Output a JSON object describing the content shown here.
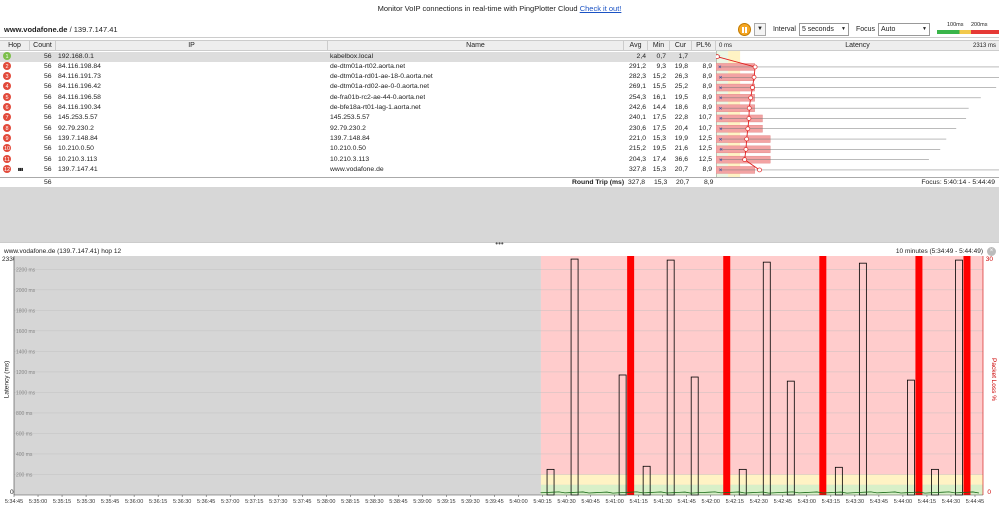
{
  "banner": {
    "text": "Monitor VoIP connections in real-time with PingPlotter Cloud",
    "link": "Check it out!"
  },
  "target": {
    "name": "www.vodafone.de",
    "sep": " / ",
    "ip": "139.7.147.41"
  },
  "controls": {
    "interval_label": "Interval",
    "interval_value": "5 seconds",
    "focus_label": "Focus",
    "focus_value": "Auto",
    "scale_low": "100ms",
    "scale_high": "200ms"
  },
  "columns": {
    "hop": "Hop",
    "count": "Count",
    "ip": "IP",
    "name": "Name",
    "avg": "Avg",
    "min": "Min",
    "cur": "Cur",
    "pl": "PL%",
    "lat_min": "0 ms",
    "latency": "Latency",
    "lat_max": "2313 ms"
  },
  "hops": [
    {
      "hop": "1",
      "count": "56",
      "ip": "192.168.0.1",
      "name": "kabelbox.local",
      "avg": "2,4",
      "min": "0,7",
      "cur": "1,7",
      "pl": "",
      "avg_ms": 2.4,
      "min_ms": 0.7,
      "cur_ms": 1.7,
      "pl_num": 0
    },
    {
      "hop": "2",
      "count": "56",
      "ip": "84.116.198.84",
      "name": "de-dtm01a-rt02.aorta.net",
      "avg": "291,2",
      "min": "9,3",
      "cur": "19,8",
      "pl": "8,9",
      "avg_ms": 291.2,
      "min_ms": 9.3,
      "cur_ms": 19.8,
      "pl_num": 8.9
    },
    {
      "hop": "3",
      "count": "56",
      "ip": "84.116.191.73",
      "name": "de-dtm01a-rd01-ae-18-0.aorta.net",
      "avg": "282,3",
      "min": "15,2",
      "cur": "26,3",
      "pl": "8,9",
      "avg_ms": 282.3,
      "min_ms": 15.2,
      "cur_ms": 26.3,
      "pl_num": 8.9
    },
    {
      "hop": "4",
      "count": "56",
      "ip": "84.116.196.42",
      "name": "de-dtm01a-rd02-ae-0-0.aorta.net",
      "avg": "269,1",
      "min": "15,5",
      "cur": "25,2",
      "pl": "8,9",
      "avg_ms": 269.1,
      "min_ms": 15.5,
      "cur_ms": 25.2,
      "pl_num": 8.9
    },
    {
      "hop": "5",
      "count": "56",
      "ip": "84.116.196.58",
      "name": "de-fra01b-rc2-ae-44-0.aorta.net",
      "avg": "254,3",
      "min": "16,1",
      "cur": "19,5",
      "pl": "8,9",
      "avg_ms": 254.3,
      "min_ms": 16.1,
      "cur_ms": 19.5,
      "pl_num": 8.9
    },
    {
      "hop": "6",
      "count": "56",
      "ip": "84.116.190.34",
      "name": "de-bfe18a-rt01-lag-1.aorta.net",
      "avg": "242,6",
      "min": "14,4",
      "cur": "18,6",
      "pl": "8,9",
      "avg_ms": 242.6,
      "min_ms": 14.4,
      "cur_ms": 18.6,
      "pl_num": 8.9
    },
    {
      "hop": "7",
      "count": "56",
      "ip": "145.253.5.57",
      "name": "145.253.5.57",
      "avg": "240,1",
      "min": "17,5",
      "cur": "22,8",
      "pl": "10,7",
      "avg_ms": 240.1,
      "min_ms": 17.5,
      "cur_ms": 22.8,
      "pl_num": 10.7
    },
    {
      "hop": "8",
      "count": "56",
      "ip": "92.79.230.2",
      "name": "92.79.230.2",
      "avg": "230,6",
      "min": "17,5",
      "cur": "20,4",
      "pl": "10,7",
      "avg_ms": 230.6,
      "min_ms": 17.5,
      "cur_ms": 20.4,
      "pl_num": 10.7
    },
    {
      "hop": "9",
      "count": "56",
      "ip": "139.7.148.84",
      "name": "139.7.148.84",
      "avg": "221,0",
      "min": "15,3",
      "cur": "19,9",
      "pl": "12,5",
      "avg_ms": 221.0,
      "min_ms": 15.3,
      "cur_ms": 19.9,
      "pl_num": 12.5
    },
    {
      "hop": "10",
      "count": "56",
      "ip": "10.210.0.50",
      "name": "10.210.0.50",
      "avg": "215,2",
      "min": "19,5",
      "cur": "21,6",
      "pl": "12,5",
      "avg_ms": 215.2,
      "min_ms": 19.5,
      "cur_ms": 21.6,
      "pl_num": 12.5
    },
    {
      "hop": "11",
      "count": "56",
      "ip": "10.210.3.113",
      "name": "10.210.3.113",
      "avg": "204,3",
      "min": "17,4",
      "cur": "36,6",
      "pl": "12,5",
      "avg_ms": 204.3,
      "min_ms": 17.4,
      "cur_ms": 36.6,
      "pl_num": 12.5
    },
    {
      "hop": "12",
      "count": "56",
      "ip": "139.7.147.41",
      "name": "www.vodafone.de",
      "avg": "327,8",
      "min": "15,3",
      "cur": "20,7",
      "pl": "8,9",
      "avg_ms": 327.8,
      "min_ms": 15.3,
      "cur_ms": 20.7,
      "pl_num": 8.9
    }
  ],
  "summary": {
    "count": "56",
    "label": "Round Trip (ms)",
    "avg": "327,8",
    "min": "15,3",
    "cur": "20,7",
    "pl": "8,9",
    "focus": "Focus: 5:40:14 - 5:44:49"
  },
  "colors": {
    "loss_bg": "#ffcccc",
    "loss_bar": "#ff0000",
    "ok_band": "#fff3c4",
    "good_band": "#d8f0c8",
    "hop_bad": "#e24a3b",
    "hop_ok": "#7cbf4a"
  },
  "lower": {
    "title": "www.vodafone.de (139.7.147.41) hop 12",
    "range": "10 minutes (5:34:49 - 5:44:49)",
    "ylabel": "Latency (ms)",
    "rlabel": "Packet Loss %",
    "ymax": "2330",
    "ymin": "0",
    "rmax": "30",
    "rmin": "0"
  },
  "chart_data": {
    "type": "bar",
    "ylabel": "Latency (ms)",
    "y2label": "Packet Loss %",
    "ylim": [
      0,
      2330
    ],
    "y2lim": [
      0,
      30
    ],
    "gridlines_ms": [
      2200,
      2000,
      1800,
      1600,
      1400,
      1200,
      1000,
      800,
      600,
      400,
      200
    ],
    "grid_labels": [
      "2200 ms",
      "2000 ms",
      "1800 ms",
      "1600 ms",
      "1400 ms",
      "1200 ms",
      "1000 ms",
      "800 ms",
      "600 ms",
      "400 ms",
      "200 ms"
    ],
    "xticks": [
      "5:34:45",
      "5:35:00",
      "5:35:15",
      "5:35:30",
      "5:35:45",
      "5:36:00",
      "5:36:15",
      "5:36:30",
      "5:36:45",
      "5:37:00",
      "5:37:15",
      "5:37:30",
      "5:37:45",
      "5:38:00",
      "5:38:15",
      "5:38:30",
      "5:38:45",
      "5:39:00",
      "5:39:15",
      "5:39:30",
      "5:39:45",
      "5:40:00",
      "5:40:15",
      "5:40:30",
      "5:40:45",
      "5:41:00",
      "5:41:15",
      "5:41:30",
      "5:41:45",
      "5:42:00",
      "5:42:15",
      "5:42:30",
      "5:42:45",
      "5:43:00",
      "5:43:15",
      "5:43:30",
      "5:43:45",
      "5:44:00",
      "5:44:15",
      "5:44:30",
      "5:44:45"
    ],
    "spikes": [
      {
        "t": "5:40:20",
        "ms": 250
      },
      {
        "t": "5:40:35",
        "ms": 2300
      },
      {
        "t": "5:41:05",
        "ms": 1170
      },
      {
        "t": "5:41:20",
        "ms": 280
      },
      {
        "t": "5:41:35",
        "ms": 2290
      },
      {
        "t": "5:41:50",
        "ms": 1150
      },
      {
        "t": "5:42:20",
        "ms": 250
      },
      {
        "t": "5:42:35",
        "ms": 2270
      },
      {
        "t": "5:42:50",
        "ms": 1110
      },
      {
        "t": "5:43:20",
        "ms": 270
      },
      {
        "t": "5:43:35",
        "ms": 2260
      },
      {
        "t": "5:44:05",
        "ms": 1120
      },
      {
        "t": "5:44:20",
        "ms": 250
      },
      {
        "t": "5:44:35",
        "ms": 2290
      }
    ],
    "loss_events": [
      "5:41:10",
      "5:42:10",
      "5:43:10",
      "5:44:10",
      "5:44:40"
    ]
  }
}
